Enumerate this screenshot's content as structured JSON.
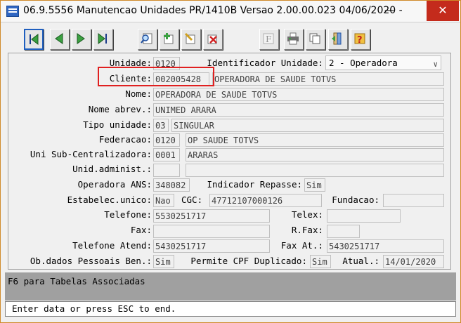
{
  "window": {
    "title": "06.9.5556 Manutencao  Unidades PR/1410B Versao 2.00.00.023 04/06/2020 -",
    "minimize": "—",
    "close": "✕"
  },
  "toolbar": {
    "items": [
      "first-record",
      "prev-record",
      "next-record",
      "last-record",
      "search",
      "add",
      "edit",
      "delete",
      "filter",
      "print",
      "copy",
      "exit",
      "help"
    ],
    "filter_label": "F"
  },
  "form": {
    "unidade": {
      "label": "Unidade:",
      "value": "0120"
    },
    "identificador": {
      "label": "Identificador Unidade:",
      "value": "2 - Operadora"
    },
    "cliente": {
      "label": "Cliente:",
      "value": "002005428",
      "desc": "OPERADORA DE SAUDE TOTVS"
    },
    "nome": {
      "label": "Nome:",
      "value": "OPERADORA DE SAUDE TOTVS"
    },
    "nome_abrev": {
      "label": "Nome abrev.:",
      "value": "UNIMED ARARA"
    },
    "tipo_unidade": {
      "label": "Tipo unidade:",
      "code": "03",
      "desc": "SINGULAR"
    },
    "federacao": {
      "label": "Federacao:",
      "code": "0120",
      "desc": "OP SAUDE TOTVS"
    },
    "uni_sub": {
      "label": "Uni Sub-Centralizadora:",
      "code": "0001",
      "desc": "ARARAS"
    },
    "unid_admin": {
      "label": "Unid.administ.:",
      "code": "",
      "desc": ""
    },
    "operadora_ans": {
      "label": "Operadora ANS:",
      "value": "348082"
    },
    "indicador_repasse": {
      "label": "Indicador Repasse:",
      "value": "Sim"
    },
    "estabelec_unico": {
      "label": "Estabelec.unico:",
      "value": "Nao"
    },
    "cgc": {
      "label": "CGC:",
      "value": "47712107000126"
    },
    "fundacao": {
      "label": "Fundacao:",
      "value": ""
    },
    "telefone": {
      "label": "Telefone:",
      "value": "5530251717"
    },
    "telex": {
      "label": "Telex:",
      "value": ""
    },
    "fax": {
      "label": "Fax:",
      "value": ""
    },
    "rfax": {
      "label": "R.Fax:",
      "value": ""
    },
    "telefone_atend": {
      "label": "Telefone Atend:",
      "value": "5430251717"
    },
    "fax_at": {
      "label": "Fax At.:",
      "value": "5430251717"
    },
    "ob_dados": {
      "label": "Ob.dados Pessoais Ben.:",
      "value": "Sim"
    },
    "permite_cpf": {
      "label": "Permite CPF Duplicado:",
      "value": "Sim"
    },
    "atual": {
      "label": "Atual.:",
      "value": "14/01/2020"
    }
  },
  "status": {
    "hint": "F6 para Tabelas Associadas",
    "prompt": "Enter data or press ESC to end."
  }
}
